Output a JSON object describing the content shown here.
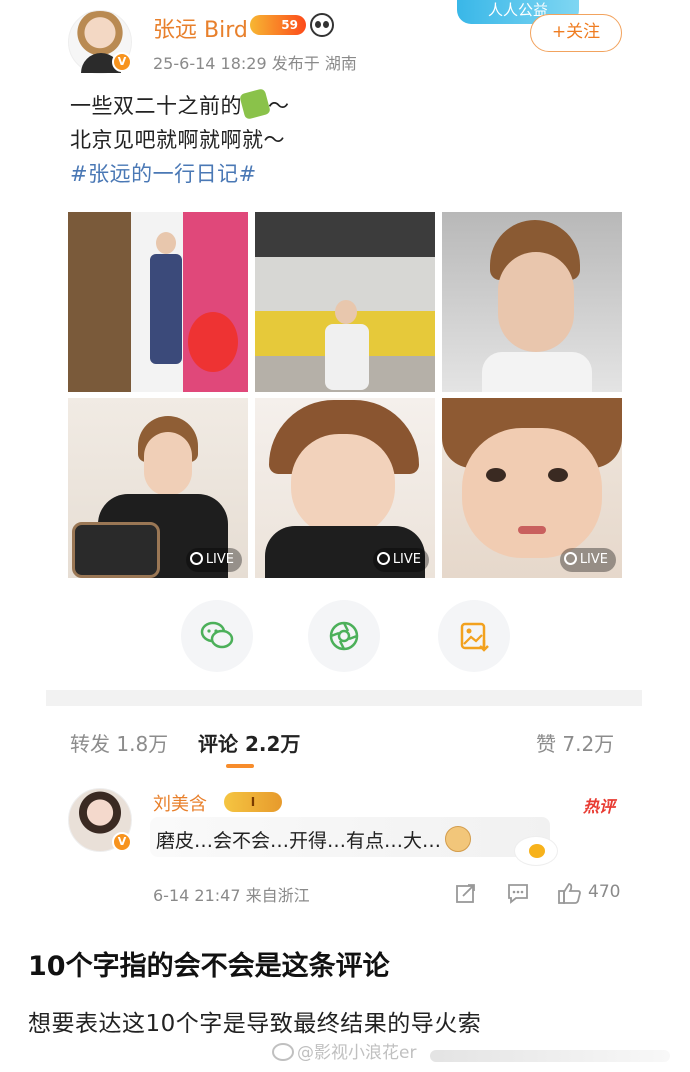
{
  "post": {
    "username": "张远 Bird",
    "level": "59",
    "meta": "25-6-14 18:29  发布于 湖南",
    "banner_text": "人人公益",
    "follow_label": "+关注",
    "line1_text": "一些双二十之前的",
    "line1_suffix": "～",
    "line2": "北京见吧就啊就啊就～",
    "hashtag": "#张远的一行日记#",
    "photos": [
      {
        "live": ""
      },
      {
        "live": ""
      },
      {
        "live": ""
      },
      {
        "live": "LIVE"
      },
      {
        "live": "LIVE"
      },
      {
        "live": "LIVE"
      }
    ],
    "share_icons": [
      "wechat-icon",
      "moments-icon",
      "save-image-icon"
    ]
  },
  "tabs": {
    "repost": "转发 1.8万",
    "comments": "评论 2.2万",
    "likes": "赞 7.2万"
  },
  "comment": {
    "name": "刘美含",
    "badge": "I",
    "hot_tag": "热评",
    "text": "磨皮…会不会…开得…有点…大…",
    "meta": "6-14 21:47  来自浙江",
    "like_count": "470"
  },
  "caption": {
    "title": "10个字指的会不会是这条评论",
    "body": "想要表达这10个字是导致最终结果的导火索"
  },
  "watermark": "@影视小浪花er",
  "colors": {
    "accent_orange": "#f78c2b",
    "username_orange": "#e8802c",
    "hashtag_blue": "#4a78b5",
    "hot_red": "#e83b32"
  }
}
